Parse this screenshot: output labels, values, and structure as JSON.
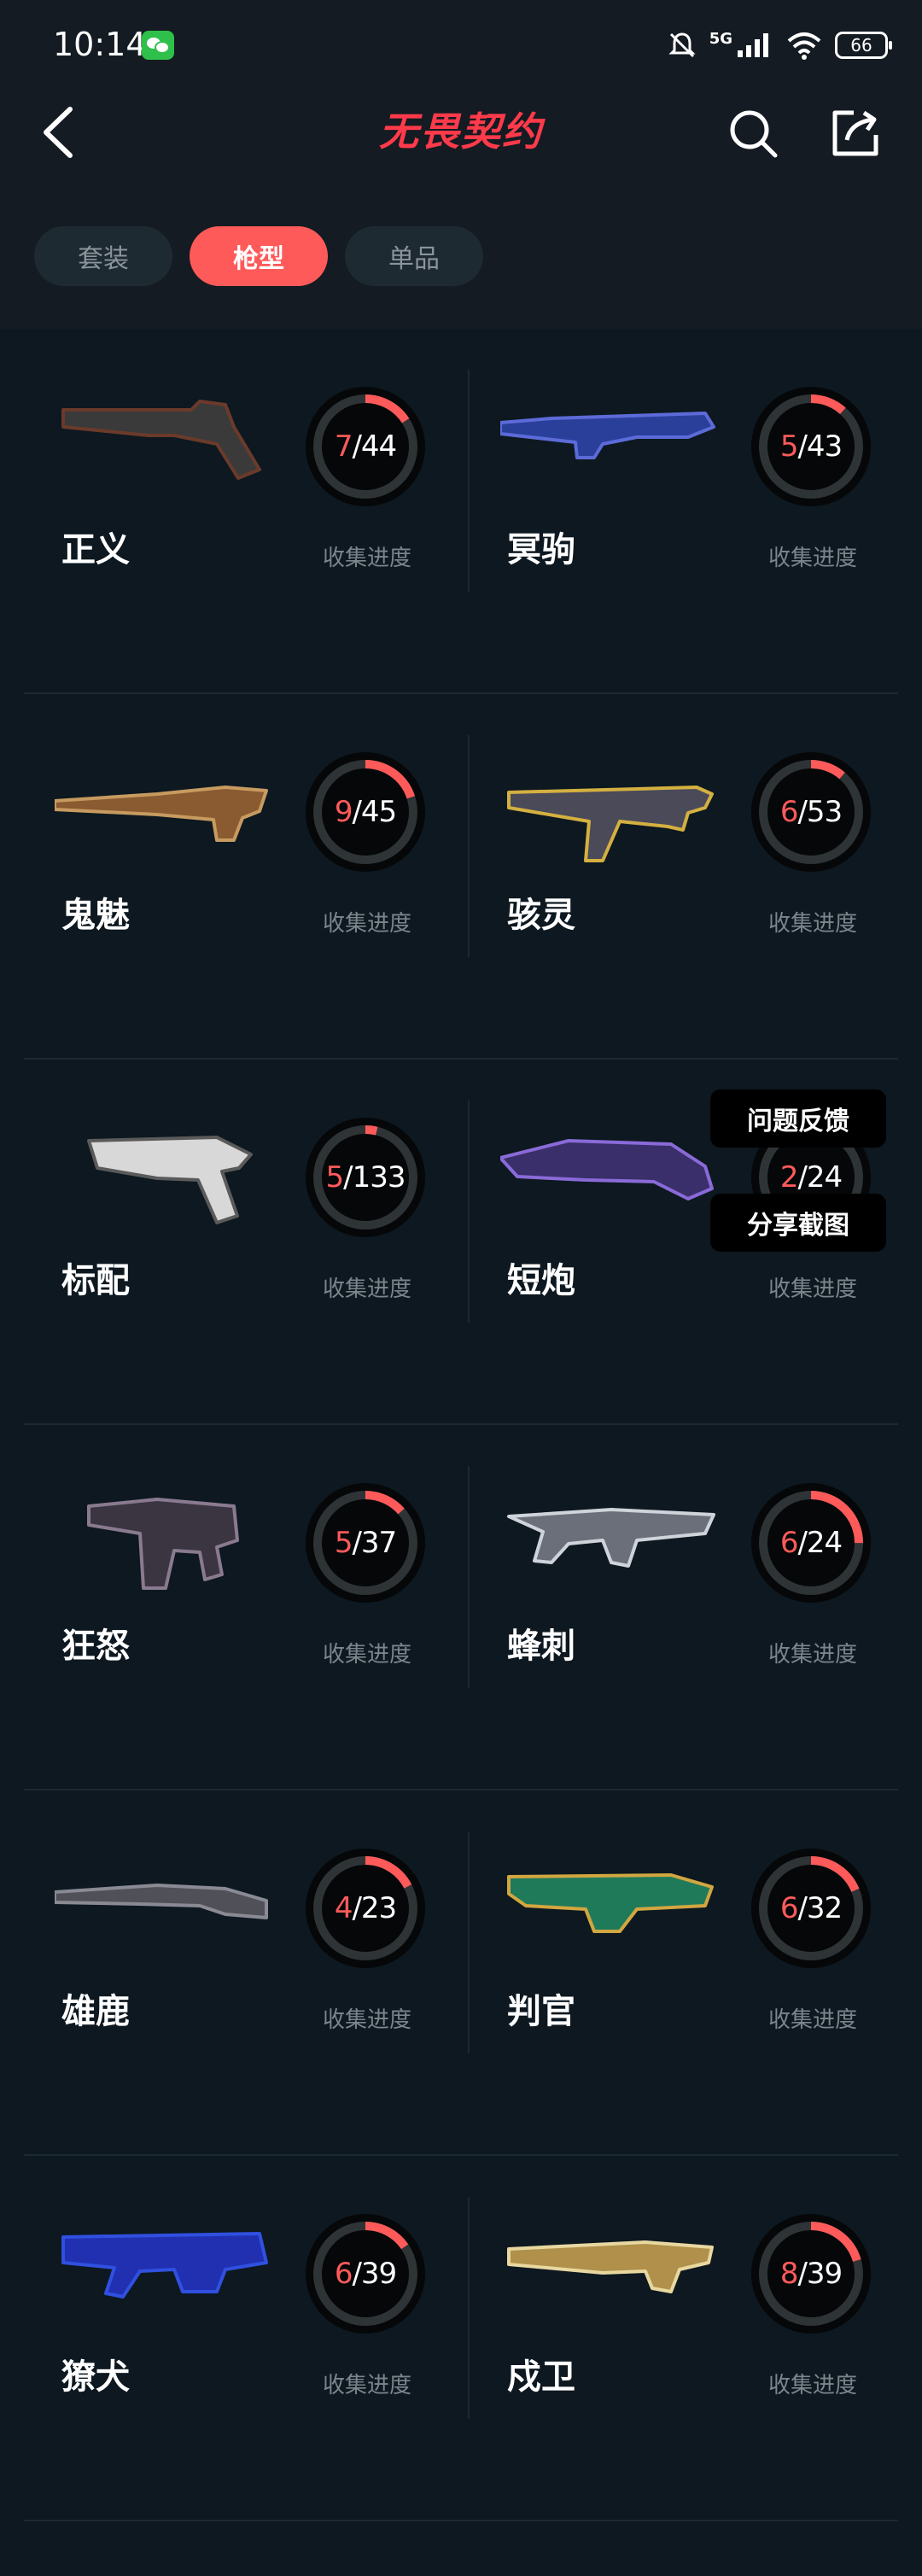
{
  "status_bar": {
    "time": "10:14",
    "signal": "5G",
    "battery": "66"
  },
  "header": {
    "title": "无畏契约"
  },
  "tabs": [
    {
      "label": "套装",
      "active": false
    },
    {
      "label": "枪型",
      "active": true
    },
    {
      "label": "单品",
      "active": false
    }
  ],
  "progress_label": "收集进度",
  "weapons": [
    {
      "name": "正义",
      "collected": "7",
      "total": "44",
      "progress": 0.159
    },
    {
      "name": "冥驹",
      "collected": "5",
      "total": "43",
      "progress": 0.116
    },
    {
      "name": "鬼魅",
      "collected": "9",
      "total": "45",
      "progress": 0.2
    },
    {
      "name": "骇灵",
      "collected": "6",
      "total": "53",
      "progress": 0.113
    },
    {
      "name": "标配",
      "collected": "5",
      "total": "133",
      "progress": 0.038
    },
    {
      "name": "短炮",
      "collected": "2",
      "total": "24",
      "progress": 0.083
    },
    {
      "name": "狂怒",
      "collected": "5",
      "total": "37",
      "progress": 0.135
    },
    {
      "name": "蜂刺",
      "collected": "6",
      "total": "24",
      "progress": 0.25
    },
    {
      "name": "雄鹿",
      "collected": "4",
      "total": "23",
      "progress": 0.174
    },
    {
      "name": "判官",
      "collected": "6",
      "total": "32",
      "progress": 0.188
    },
    {
      "name": "獠犬",
      "collected": "6",
      "total": "39",
      "progress": 0.154
    },
    {
      "name": "戍卫",
      "collected": "8",
      "total": "39",
      "progress": 0.205
    }
  ],
  "floating": {
    "feedback": "问题反馈",
    "screenshot": "分享截图"
  },
  "colors": {
    "accent": "#ff5a5a",
    "ring_track": "#2e3336",
    "background": "#0d1820"
  }
}
